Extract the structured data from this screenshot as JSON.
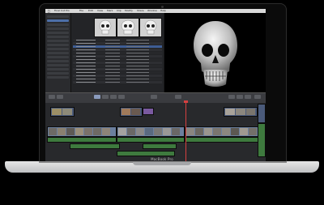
{
  "brand_text": "MacBook Pro",
  "menubar": {
    "items": [
      "Final Cut Pro",
      "File",
      "Edit",
      "View",
      "Mark",
      "Clip",
      "Modify",
      "Share",
      "Window",
      "Help"
    ]
  },
  "icons": [
    "apple-icon",
    "skull-image"
  ],
  "colors": {
    "video_clip": "#4a5a7a",
    "audio_clip": "#3e7a3e",
    "selection": "#3e5d94",
    "playhead": "#d64040"
  }
}
